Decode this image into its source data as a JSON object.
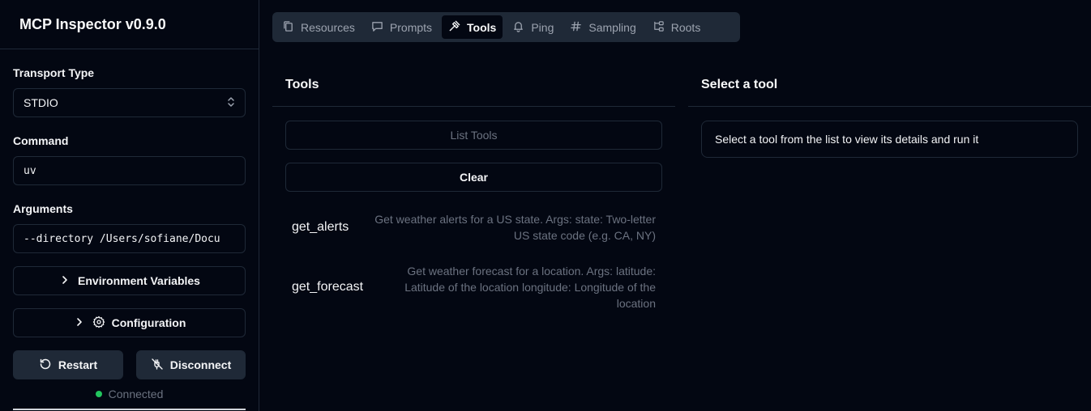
{
  "sidebar": {
    "title": "MCP Inspector v0.9.0",
    "transport_label": "Transport Type",
    "transport_value": "STDIO",
    "command_label": "Command",
    "command_value": "uv",
    "arguments_label": "Arguments",
    "arguments_value": "--directory /Users/sofiane/Docu",
    "env_button": "Environment Variables",
    "config_button": "Configuration",
    "restart_button": "Restart",
    "disconnect_button": "Disconnect",
    "status": "Connected"
  },
  "tabs": [
    {
      "label": "Resources",
      "icon": "files-icon"
    },
    {
      "label": "Prompts",
      "icon": "message-square-icon"
    },
    {
      "label": "Tools",
      "icon": "hammer-icon",
      "active": true
    },
    {
      "label": "Ping",
      "icon": "bell-icon"
    },
    {
      "label": "Sampling",
      "icon": "hash-icon"
    },
    {
      "label": "Roots",
      "icon": "folder-tree-icon"
    }
  ],
  "tools_panel": {
    "title": "Tools",
    "list_button": "List Tools",
    "clear_button": "Clear",
    "tools": [
      {
        "name": "get_alerts",
        "description_line1": "Get weather alerts for a US state. Args: state: Two-letter",
        "description_line2": "US state code (e.g. CA, NY)"
      },
      {
        "name": "get_forecast",
        "description_line1": "Get weather forecast for a location. Args: latitude:",
        "description_line2": "Latitude of the location longitude: Longitude of the",
        "description_line3": "location"
      }
    ]
  },
  "detail_panel": {
    "title": "Select a tool",
    "message": "Select a tool from the list to view its details and run it"
  },
  "colors": {
    "background": "#030712",
    "border": "#1f2937",
    "tab_bar": "#1f2937",
    "status_ok": "#22c55e",
    "muted_text": "#6b7280"
  }
}
